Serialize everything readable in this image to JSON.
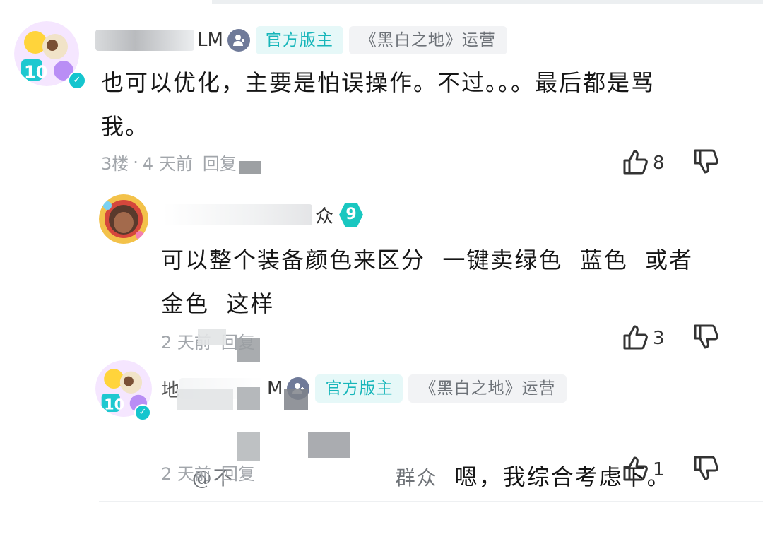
{
  "comments": [
    {
      "user": {
        "name_tail": "LM",
        "badge_moderator": "官方版主",
        "badge_operator": "《黑白之地》运营"
      },
      "text": "也可以优化，主要是怕误操作。不过。。。最后都是骂\n我。",
      "floor": "3楼",
      "time": "4 天前",
      "reply": "回复",
      "likes": "8"
    },
    {
      "user": {
        "name_tail": "众",
        "level": "9"
      },
      "text": "可以整个装备颜色来区分  一键卖绿色  蓝色  或者\n金色  这样",
      "time": "2 天前",
      "reply": "回复",
      "likes": "3"
    },
    {
      "user": {
        "name_head": "地",
        "name_tail": "M",
        "badge_moderator": "官方版主",
        "badge_operator": "《黑白之地》运营"
      },
      "mention_head": "@不",
      "mention_tail": "群众",
      "text": "嗯，我综合考虑下。",
      "time": "2 天前",
      "reply": "回复",
      "likes": "1"
    }
  ],
  "colors": {
    "accent": "#17b6ba",
    "badge_bg": "#e6f8f8",
    "meta_text": "#a2a6ab"
  },
  "icons": {
    "like": "thumbs-up-icon",
    "dislike": "thumbs-down-icon",
    "role": "moderator-person-icon"
  }
}
